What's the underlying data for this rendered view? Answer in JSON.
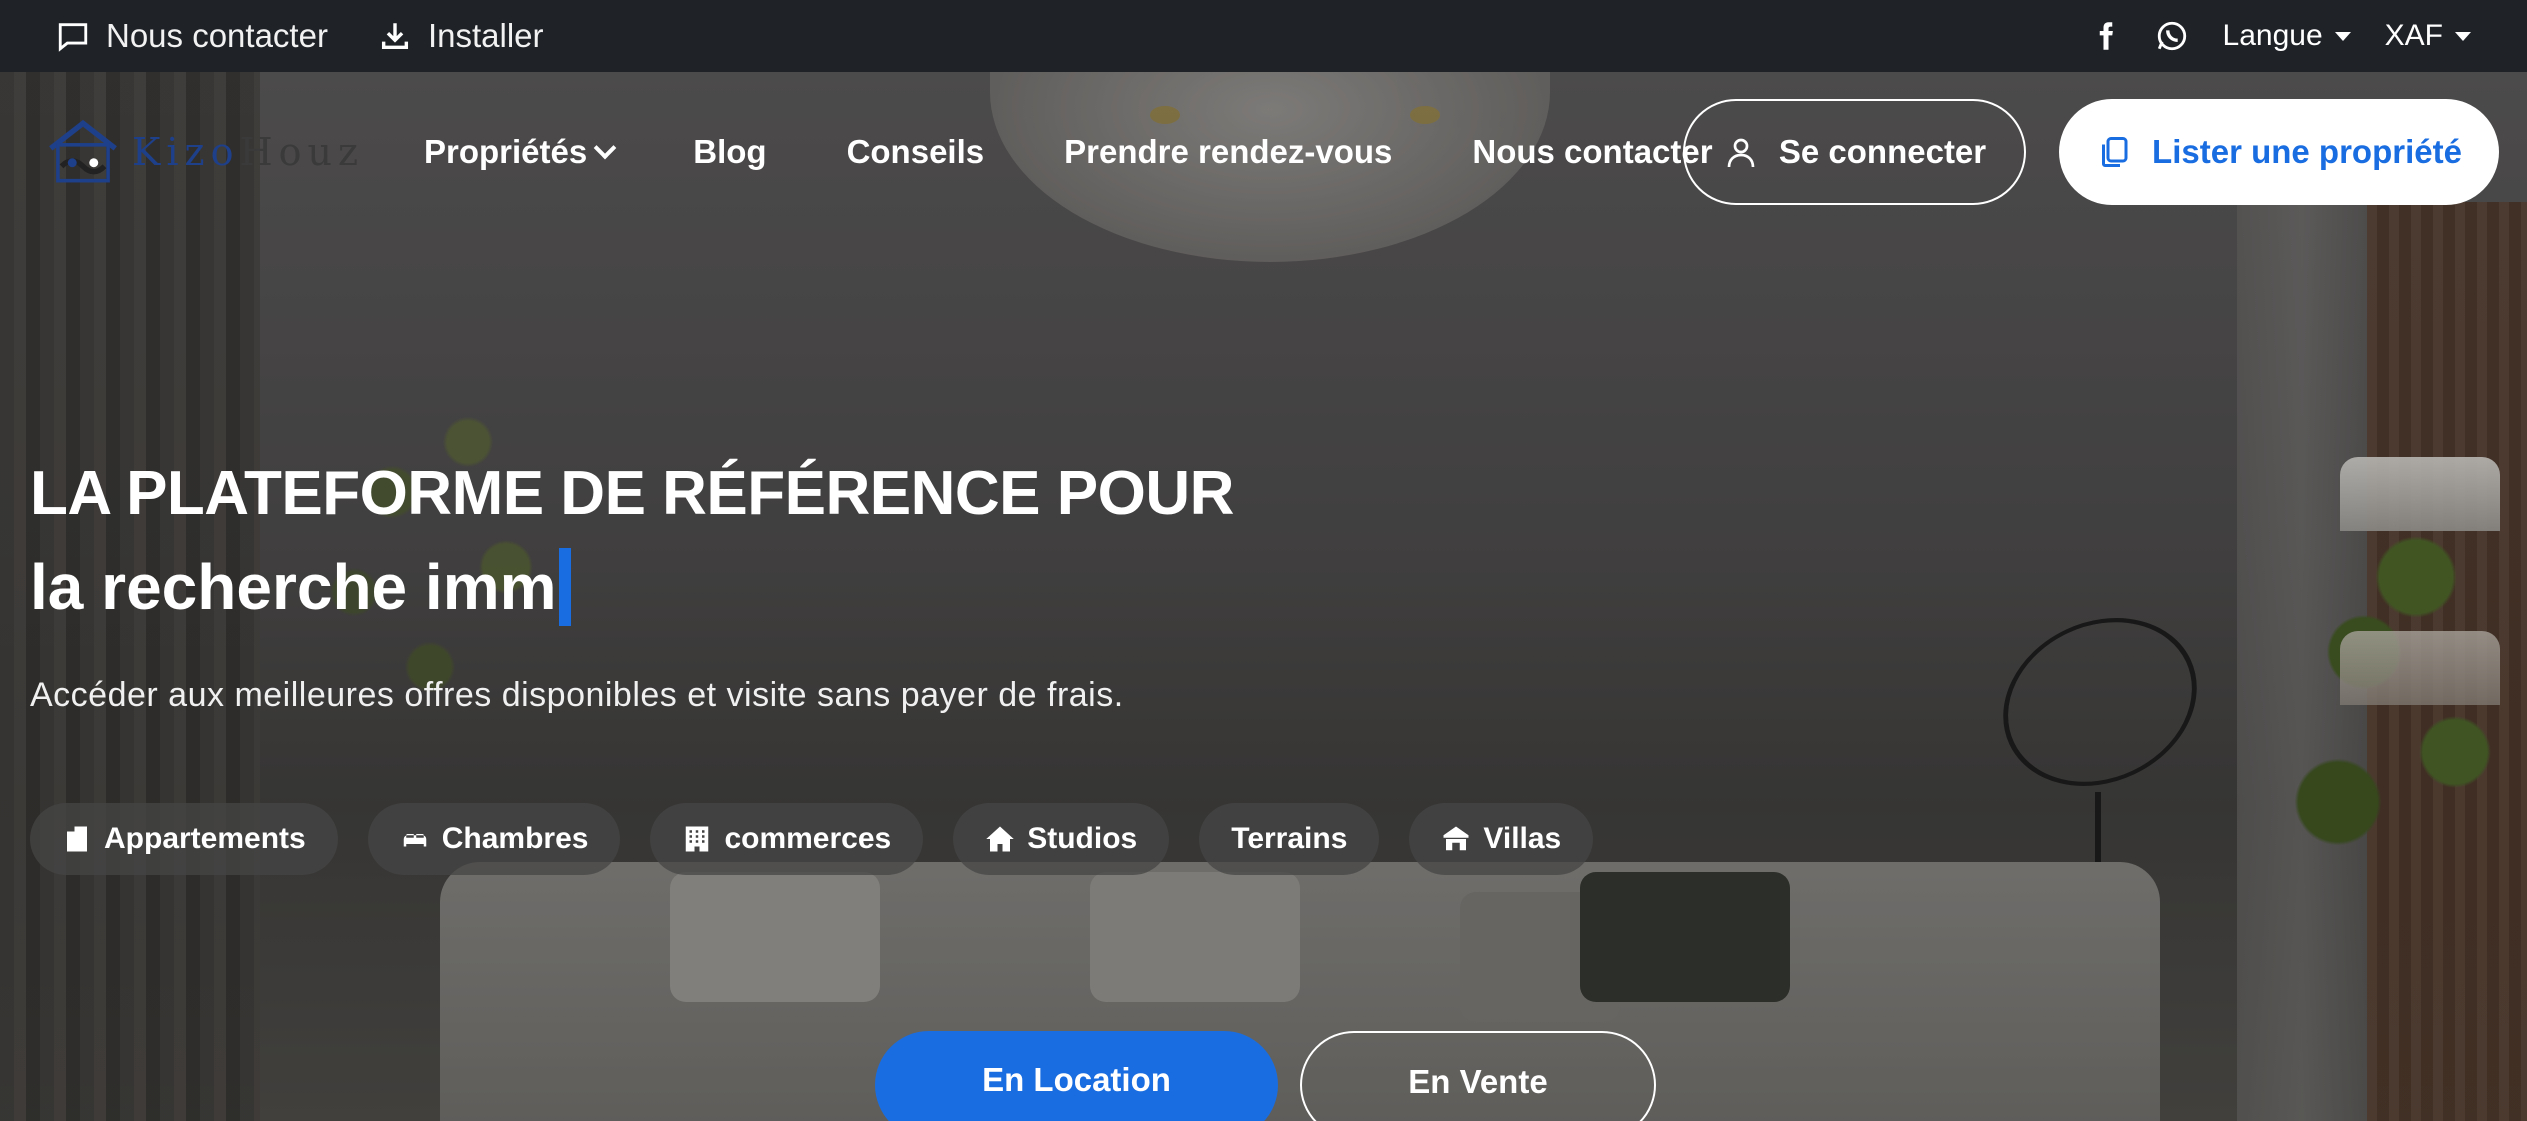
{
  "topbar": {
    "contact_label": "Nous contacter",
    "install_label": "Installer",
    "language_label": "Langue",
    "currency_label": "XAF",
    "icons": [
      "chat-icon",
      "download-icon",
      "facebook-icon",
      "whatsapp-icon"
    ]
  },
  "navbar": {
    "logo": {
      "part1": "Kizo",
      "part2": "Houz"
    },
    "links": [
      "Propriétés",
      "Blog",
      "Conseils",
      "Prendre rendez-vous",
      "Nous contacter"
    ],
    "login_label": "Se connecter",
    "list_property_label": "Lister une propriété"
  },
  "hero": {
    "headline_line1": "LA PLATEFORME DE RÉFÉRENCE POUR",
    "headline_line2": "la recherche imm",
    "subtitle": "Accéder aux meilleures offres disponibles et visite sans payer de frais.",
    "categories": [
      "Appartements",
      "Chambres",
      "commerces",
      "Studios",
      "Terrains",
      "Villas"
    ],
    "mode_tabs": [
      "En Location",
      "En Vente"
    ]
  },
  "colors": {
    "accent": "#1a6de0",
    "topbar_bg": "#1f2328",
    "logo_blue": "#1e3f8a"
  }
}
